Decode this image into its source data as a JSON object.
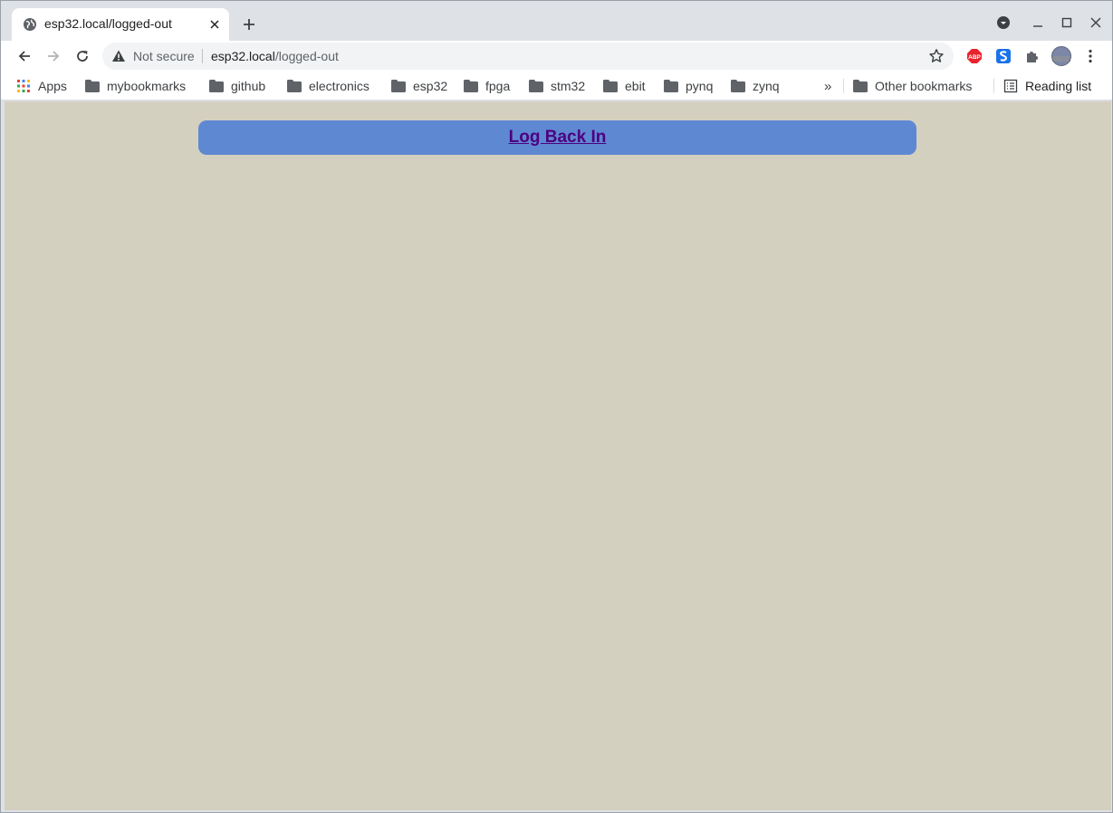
{
  "tab": {
    "title": "esp32.local/logged-out"
  },
  "omnibox": {
    "security_label": "Not secure",
    "url_host": "esp32.local",
    "url_path": "/logged-out"
  },
  "bookmarks": {
    "apps_label": "Apps",
    "items": [
      {
        "label": "mybookmarks"
      },
      {
        "label": "github"
      },
      {
        "label": "electronics"
      },
      {
        "label": "esp32"
      },
      {
        "label": "fpga"
      },
      {
        "label": "stm32"
      },
      {
        "label": "ebit"
      },
      {
        "label": "pynq"
      },
      {
        "label": "zynq"
      }
    ],
    "overflow": "»",
    "other_label": "Other bookmarks",
    "reading_list_label": "Reading list"
  },
  "page": {
    "link_text": "Log Back In",
    "background_color": "#d4d0c0",
    "banner_color": "#5f88d3",
    "link_color": "#4d0080"
  },
  "extensions": {
    "abp_label": "ABP"
  }
}
